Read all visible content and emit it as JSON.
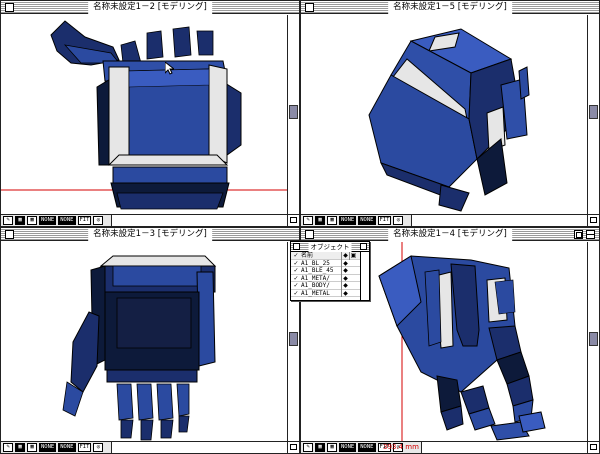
{
  "windows": [
    {
      "id": "w1",
      "title": "名称未設定1－2 [モデリング]"
    },
    {
      "id": "w2",
      "title": "名称未設定1－5 [モデリング]"
    },
    {
      "id": "w3",
      "title": "名称未設定1－3 [モデリング]"
    },
    {
      "id": "w4",
      "title": "名称未設定1－4 [モデリング]"
    }
  ],
  "toolbar": {
    "tool_none_1": "NONE",
    "tool_none_2": "NONE",
    "tool_fit": "FIT"
  },
  "status": {
    "scale_readout": "393.4 mm"
  },
  "object_palette": {
    "title": "オブジェクト",
    "header": {
      "name": "名前"
    },
    "items": [
      {
        "check": "✓",
        "name": "A1_BL_25"
      },
      {
        "check": "✓",
        "name": "A1_BLE_45"
      },
      {
        "check": "✓",
        "name": "A1_META/"
      },
      {
        "check": "✓",
        "name": "A1_BODY/"
      },
      {
        "check": "✓",
        "name": "A1_METAL"
      }
    ]
  },
  "colors": {
    "model_blue": "#2b4aa0",
    "model_dark": "#0d1a3a",
    "model_light": "#3a5cc0",
    "guide_red": "#d40000",
    "desktop": "#bdbdbd"
  }
}
